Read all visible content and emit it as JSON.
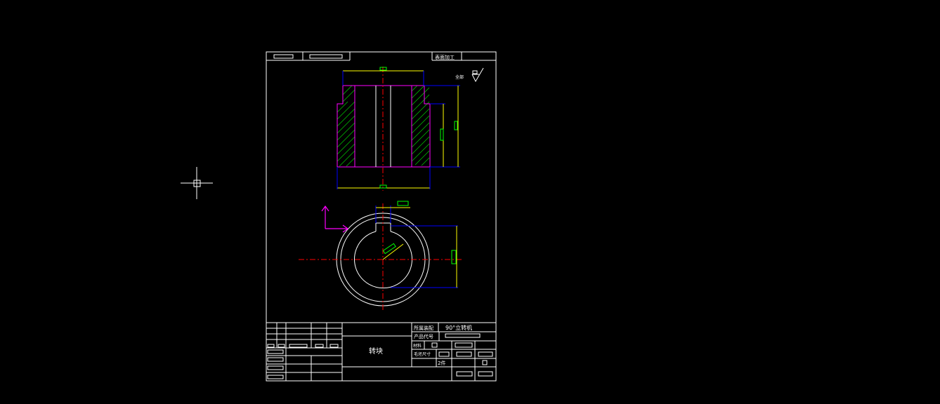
{
  "colors": {
    "background": "#000000",
    "border": "#ffffff",
    "part_outline": "#ff00ff",
    "dimension": "#0000ff",
    "extension": "#ffff00",
    "hatch": "#00c000",
    "dim_text_box": "#00ff00",
    "center_line": "#ff0000",
    "cursor": "#ffffff"
  },
  "title_top": {
    "surface_treatment": "表面加工"
  },
  "roughness_note": {
    "label": "全部"
  },
  "title_block": {
    "part_name": "转块",
    "assembly_label": "所属装配",
    "assembly_value": "90°立转机",
    "product_code_label": "产品代号",
    "material_label": "材料",
    "blank_size_label": "毛坯尺寸",
    "quantity_value": "2件"
  },
  "icons": {
    "cursor": "crosshair-icon",
    "ucs": "ucs-axis-icon",
    "roughness": "surface-roughness-icon"
  }
}
